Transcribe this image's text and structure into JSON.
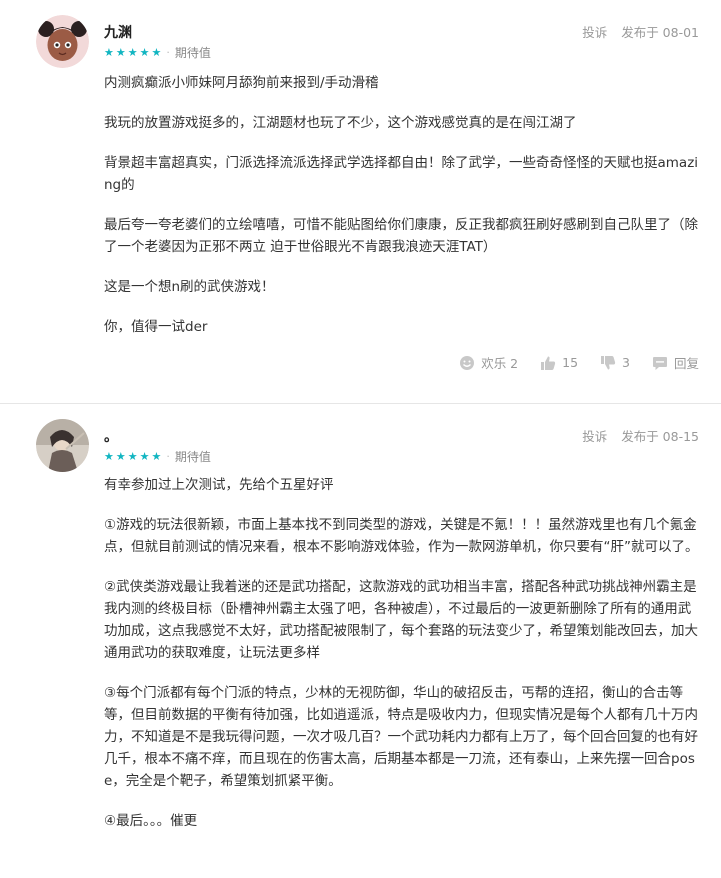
{
  "reviews": [
    {
      "username": "九渊",
      "rating_label": "期待值",
      "stars": 5,
      "report": "投诉",
      "posted": "发布于 08-01",
      "paragraphs": [
        "内测疯癫派小师妹阿月舔狗前来报到/手动滑稽",
        "我玩的放置游戏挺多的，江湖题材也玩了不少，这个游戏感觉真的是在闯江湖了",
        "背景超丰富超真实，门派选择流派选择武学选择都自由！除了武学，一些奇奇怪怪的天赋也挺amazing的",
        "最后夸一夸老婆们的立绘嘻嘻，可惜不能贴图给你们康康，反正我都疯狂刷好感刷到自己队里了（除了一个老婆因为正邪不两立 迫于世俗眼光不肯跟我浪迹天涯TAT）",
        "这是一个想n刷的武侠游戏！",
        "你，值得一试der"
      ],
      "fun_label": "欢乐 2",
      "likes": "15",
      "dislikes": "3",
      "reply": "回复"
    },
    {
      "username": "。",
      "rating_label": "期待值",
      "stars": 5,
      "report": "投诉",
      "posted": "发布于 08-15",
      "paragraphs": [
        "有幸参加过上次测试，先给个五星好评",
        "①游戏的玩法很新颖，市面上基本找不到同类型的游戏，关键是不氪！！！虽然游戏里也有几个氪金点，但就目前测试的情况来看，根本不影响游戏体验，作为一款网游单机，你只要有“肝”就可以了。",
        "②武侠类游戏最让我着迷的还是武功搭配，这款游戏的武功相当丰富，搭配各种武功挑战神州霸主是我内测的终极目标（卧槽神州霸主太强了吧，各种被虐），不过最后的一波更新删除了所有的通用武功加成，这点我感觉不太好，武功搭配被限制了，每个套路的玩法变少了，希望策划能改回去，加大通用武功的获取难度，让玩法更多样",
        "③每个门派都有每个门派的特点，少林的无视防御，华山的破招反击，丐帮的连招，衡山的合击等等，但目前数据的平衡有待加强，比如逍遥派，特点是吸收内力，但现实情况是每个人都有几十万内力，不知道是不是我玩得问题，一次才吸几百？一个武功耗内力都有上万了，每个回合回复的也有好几千，根本不痛不痒，而且现在的伤害太高，后期基本都是一刀流，还有泰山，上来先摆一回合pose，完全是个靶子，希望策划抓紧平衡。",
        "④最后。。。催更"
      ]
    }
  ],
  "colors": {
    "star": "#11b5c1",
    "muted": "#999999",
    "text": "#333333"
  }
}
